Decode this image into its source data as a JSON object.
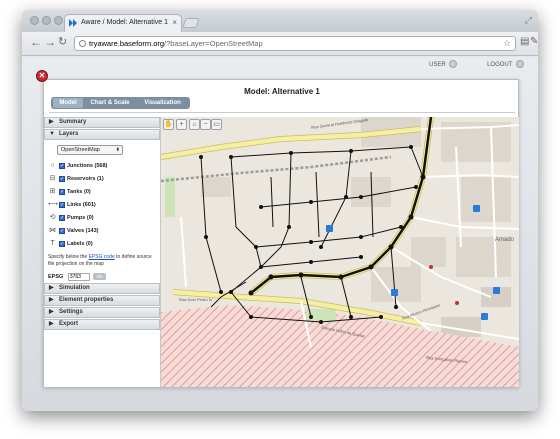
{
  "browser": {
    "tab_title": "Aware / Model: Alternative 1",
    "tab_close": "×",
    "address_domain": "tryaware.baseform.org",
    "address_path": "/?baseLayer=OpenStreetMap",
    "icons": [
      "back-icon",
      "forward-icon",
      "reload-icon",
      "star-icon",
      "page-icon",
      "wrench-icon"
    ]
  },
  "topbar": {
    "user_label": "USER",
    "logout_label": "LOGOUT"
  },
  "model": {
    "title": "Model: Alternative 1"
  },
  "tabs": [
    {
      "label": "Model",
      "active": true
    },
    {
      "label": "Chart & Scale",
      "active": false
    },
    {
      "label": "Visualization",
      "active": false
    }
  ],
  "sidebar": {
    "summary": "Summary",
    "layers": "Layers",
    "basemap": "OpenStreetMap",
    "layer_items": [
      {
        "label": "Junctions (568)",
        "icon": "junction-icon",
        "checked": true
      },
      {
        "label": "Reservoirs (1)",
        "icon": "reservoir-icon",
        "checked": true
      },
      {
        "label": "Tanks (0)",
        "icon": "tank-icon",
        "checked": true
      },
      {
        "label": "Links (601)",
        "icon": "link-icon",
        "checked": true
      },
      {
        "label": "Pumps (0)",
        "icon": "pump-icon",
        "checked": true
      },
      {
        "label": "Valves (143)",
        "icon": "valve-icon",
        "checked": true
      },
      {
        "label": "Labels (0)",
        "icon": "label-icon",
        "checked": true
      }
    ],
    "proj_text_before": "Specify below the ",
    "proj_link": "EPSG code",
    "proj_text_after": " to define source file projection on the map",
    "epsg_label": "EPSG",
    "epsg_value": "3763",
    "epsg_button": "OK",
    "sections_after": [
      "Simulation",
      "Element properties",
      "Settings",
      "Export"
    ]
  },
  "map": {
    "labels": {
      "street1": "Rua General Humberto Delgado",
      "street2": "Rua Dom Pedro IV",
      "street3": "Estrada Velha de Queluz",
      "street4": "Rua Gonçalves Ramos",
      "street5": "Rua Afonso Henriques",
      "place": "Amado"
    }
  },
  "colors": {
    "close_red": "#c8272c",
    "tab_bar": "#7d8f9f",
    "tab_active": "#9fb1c1",
    "checkbox": "#2e6fcf",
    "road_major": "#f6eea0",
    "map_bg": "#ece7de",
    "hatch": "#e59a94"
  }
}
